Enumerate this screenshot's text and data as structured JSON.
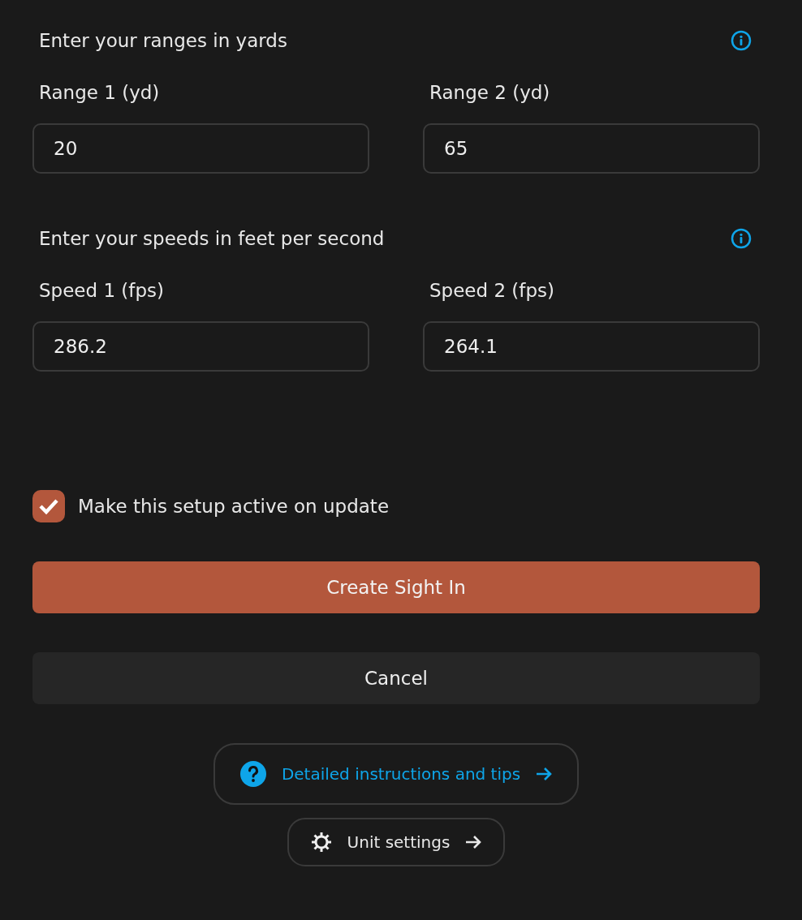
{
  "sections": [
    {
      "heading": "Enter your ranges in yards",
      "fields": [
        {
          "label": "Range 1 (yd)",
          "value": "20"
        },
        {
          "label": "Range 2 (yd)",
          "value": "65"
        }
      ]
    },
    {
      "heading": "Enter your speeds in feet per second",
      "fields": [
        {
          "label": "Speed 1 (fps)",
          "value": "286.2"
        },
        {
          "label": "Speed 2 (fps)",
          "value": "264.1"
        }
      ]
    }
  ],
  "checkbox": {
    "label": "Make this setup active on update",
    "checked": true
  },
  "primary_button": "Create Sight In",
  "cancel_button": "Cancel",
  "links": [
    {
      "kind": "help",
      "label": "Detailed instructions and tips"
    },
    {
      "kind": "settings",
      "label": "Unit settings"
    }
  ]
}
